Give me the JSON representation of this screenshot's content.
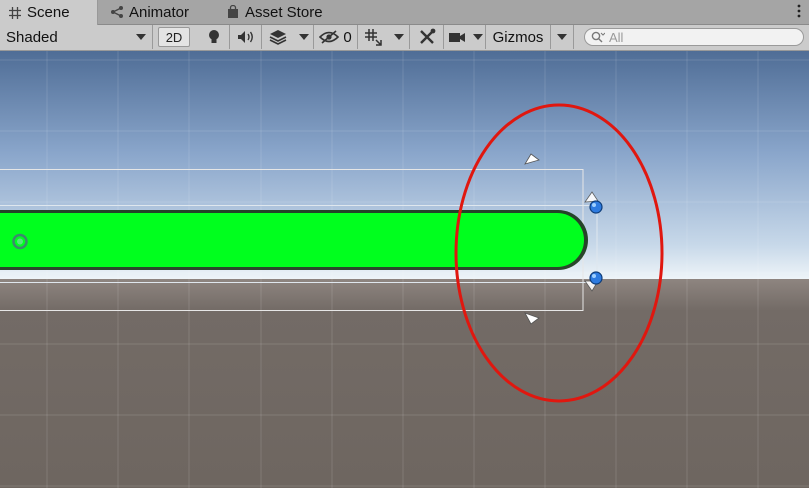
{
  "tabs": [
    {
      "label": "Scene",
      "icon": "grid-icon"
    },
    {
      "label": "Animator",
      "icon": "animator-icon"
    },
    {
      "label": "Asset Store",
      "icon": "store-bag-icon"
    }
  ],
  "toolbar": {
    "shading_mode": "Shaded",
    "mode_2d_label": "2D",
    "hidden_count": "0",
    "gizmos_label": "Gizmos",
    "search_placeholder": "All"
  },
  "scene": {
    "sky_top": "#4f6d96",
    "sky_horizon": "#e8f0f6",
    "ground": "#6e6660",
    "bar_fill": "#00ff1e",
    "annotation_color": "#e0170f",
    "handle_color": "#2e7be0"
  }
}
